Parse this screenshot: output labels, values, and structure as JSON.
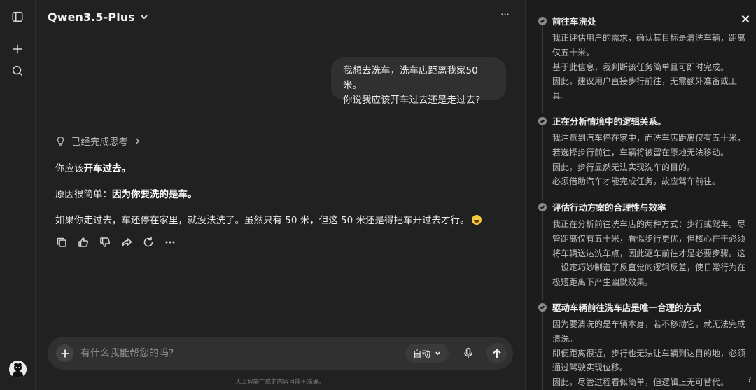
{
  "header": {
    "model_name": "Qwen3.5-Plus"
  },
  "rail": {
    "icons": [
      "sidebar-toggle-icon",
      "new-chat-icon",
      "search-icon"
    ]
  },
  "user_message": {
    "line1": "我想去洗车，洗车店距离我家50米。",
    "line2": "你说我应该开车过去还是走过去?"
  },
  "assistant": {
    "thinking_label": "已经完成思考",
    "para1_prefix": "你应该",
    "para1_bold": "开车过去。",
    "para2_prefix": "原因很简单：",
    "para2_bold": "因为你要洗的是车。",
    "para3": "如果你走过去，车还停在家里，就没法洗了。虽然只有 50 米，但这 50 米还是得把车开过去才行。",
    "actions": [
      "copy-icon",
      "thumbs-up-icon",
      "thumbs-down-icon",
      "share-icon",
      "regenerate-icon",
      "more-icon"
    ]
  },
  "composer": {
    "placeholder": "有什么我能帮您的吗?",
    "mode": "自动"
  },
  "disclaimer": "人工智能生成的内容可能不准确。",
  "thinking_panel": {
    "steps": [
      {
        "title": "前往车洗处",
        "lines": [
          "我正评估用户的需求，确认其目标是清洗车辆，距离",
          "仅五十米。",
          "基于此信息，我判断该任务简单且可即时完成。",
          "因此，建议用户直接步行前往，无需额外准备或工",
          "具。"
        ]
      },
      {
        "title": "正在分析情境中的逻辑关系。",
        "lines": [
          "我注意到汽车停在家中，而洗车店距离仅有五十米，",
          "若选择步行前往，车辆将被留在原地无法移动。",
          "因此，步行显然无法实现洗车的目的。",
          "必须借助汽车才能完成任务，故应驾车前往。"
        ]
      },
      {
        "title": "评估行动方案的合理性与效率",
        "lines": [
          "我正在分析前往洗车店的两种方式：步行或驾车。尽",
          "管距离仅有五十米，看似步行更优，但核心在于必须",
          "将车辆送达洗车点，因此驱车前往才是必要步骤。这",
          "一设定巧妙制造了反直觉的逻辑反差，使日常行为在",
          "极短距离下产生幽默效果。"
        ]
      },
      {
        "title": "驱动车辆前往洗车店是唯一合理的方式",
        "lines": [
          "因为要清洗的是车辆本身，若不移动它，就无法完成",
          "清洗。",
          "即便距离很近，步行也无法让车辆到达目的地，必须",
          "通过驾驶实现位移。",
          "因此，尽管过程看似简单，但逻辑上无可替代。"
        ]
      }
    ]
  },
  "help": "?"
}
